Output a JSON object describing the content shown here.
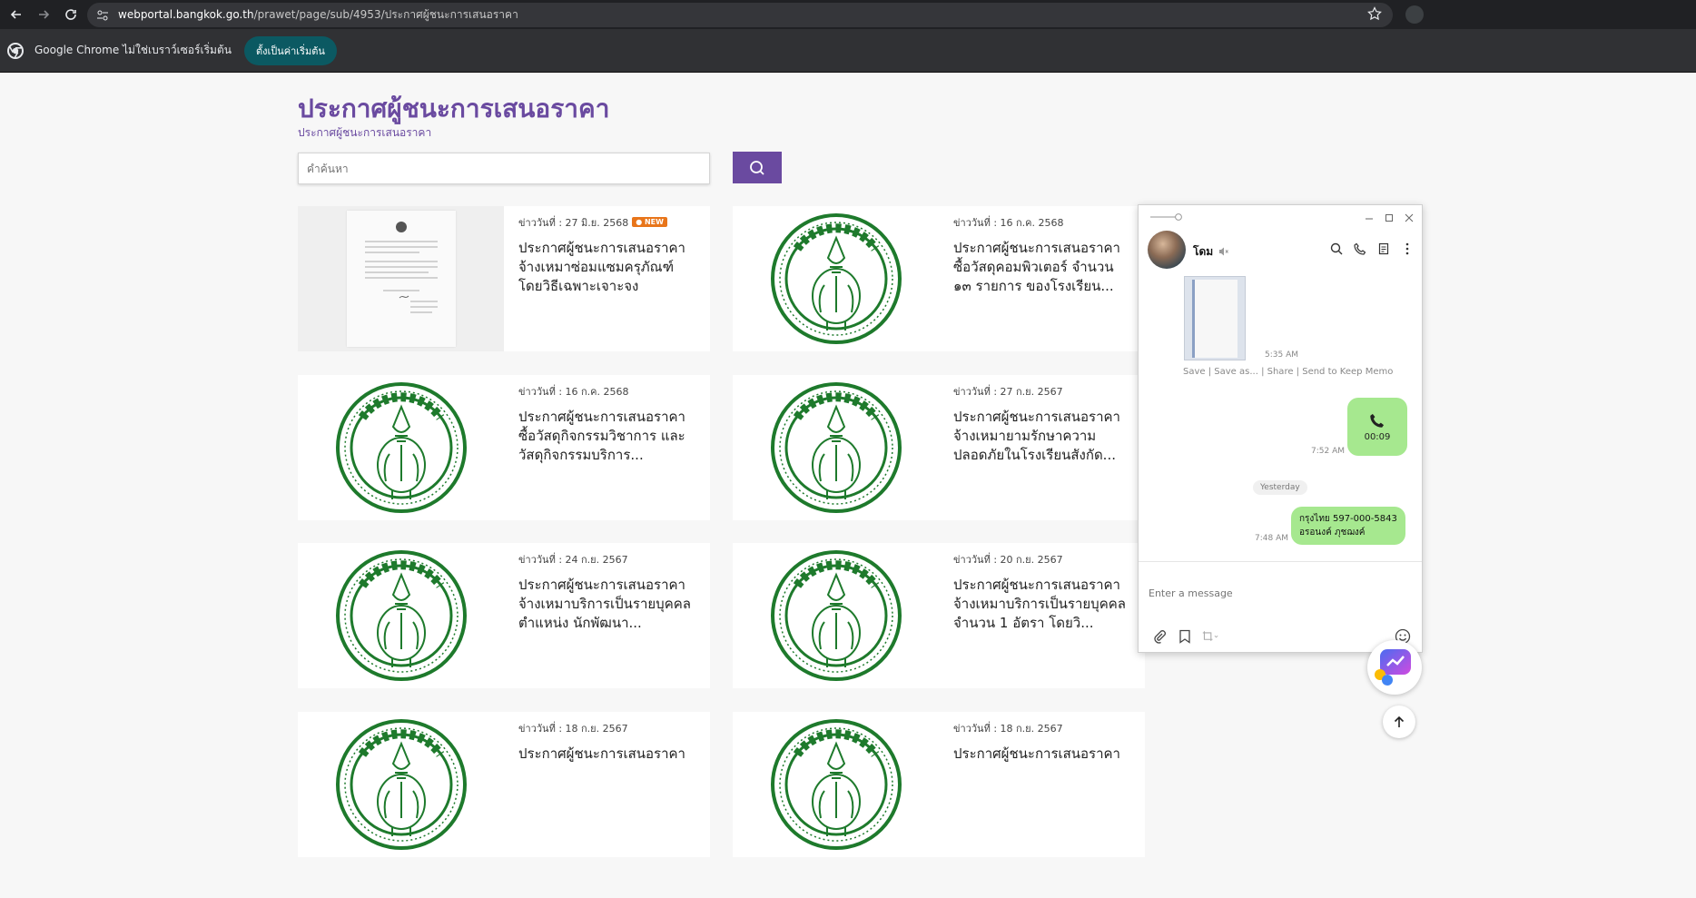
{
  "browser": {
    "url_host": "webportal.bangkok.go.th",
    "url_path": "/prawet/page/sub/4953/ประกาศผู้ชนะการเสนอราคา",
    "infobar_text": "Google Chrome ไม่ใช่เบราว์เซอร์เริ่มต้น",
    "set_default_label": "ตั้งเป็นค่าเริ่มต้น"
  },
  "page": {
    "title": "ประกาศผู้ชนะการเสนอราคา",
    "subtitle": "ประกาศผู้ชนะการเสนอราคา",
    "search_placeholder": "คำค้นหา"
  },
  "cards": [
    {
      "date": "ข่าววันที่ : 27 มิ.ย. 2568",
      "new_badge": "NEW",
      "title": "ประกาศผู้ชนะการเสนอราคา จ้างเหมาซ่อมแซมครุภัณฑ์ โดยวิธีเฉพาะเจาะจง",
      "thumb": "document"
    },
    {
      "date": "ข่าววันที่ : 16 ก.ค. 2568",
      "title": "ประกาศผู้ชนะการเสนอราคา ซื้อวัสดุคอมพิวเตอร์ จำนวน ๑๓ รายการ ของโรงเรียน...",
      "thumb": "seal"
    },
    {
      "date": "ข่าววันที่ : 16 ก.ค. 2568",
      "title": "ประกาศผู้ชนะการเสนอราคา ซื้อวัสดุกิจกรรมวิชาการ และวัสดุกิจกรรมบริการ...",
      "thumb": "seal"
    },
    {
      "date": "ข่าววันที่ : 27 ก.ย. 2567",
      "title": "ประกาศผู้ชนะการเสนอราคา จ้างเหมายามรักษาความปลอดภัยในโรงเรียนสังกัด...",
      "thumb": "seal"
    },
    {
      "date": "ข่าววันที่ : 24 ก.ย. 2567",
      "title": "ประกาศผู้ชนะการเสนอราคา จ้างเหมาบริการเป็นรายบุคคล ตำแหน่ง นักพัฒนา...",
      "thumb": "seal"
    },
    {
      "date": "ข่าววันที่ : 20 ก.ย. 2567",
      "title": "ประกาศผู้ชนะการเสนอราคา จ้างเหมาบริการเป็นรายบุคคล จำนวน 1 อัตรา โดยวิ...",
      "thumb": "seal"
    },
    {
      "date": "ข่าววันที่ : 18 ก.ย. 2567",
      "title": "ประกาศผู้ชนะการเสนอราคา",
      "thumb": "seal"
    },
    {
      "date": "ข่าววันที่ : 18 ก.ย. 2567",
      "title": "ประกาศผู้ชนะการเสนอราคา",
      "thumb": "seal"
    }
  ],
  "chat": {
    "contact_name": "โดม",
    "image_time": "5:35 AM",
    "image_actions": [
      "Save",
      "Save as...",
      "Share",
      "Send to Keep Memo"
    ],
    "call_duration": "00:09",
    "call_time": "7:52 AM",
    "day_divider": "Yesterday",
    "text_message_line1": "กรุงไทย 597-000-5843",
    "text_message_line2": "อรอนงค์ ภุชฌงค์",
    "text_time": "7:48 AM",
    "input_placeholder": "Enter a message"
  },
  "colors": {
    "brand_purple": "#6a4aa0",
    "seal_green": "#1e7a2c",
    "chat_bubble": "#a6e88f",
    "new_badge": "#e8751a"
  }
}
